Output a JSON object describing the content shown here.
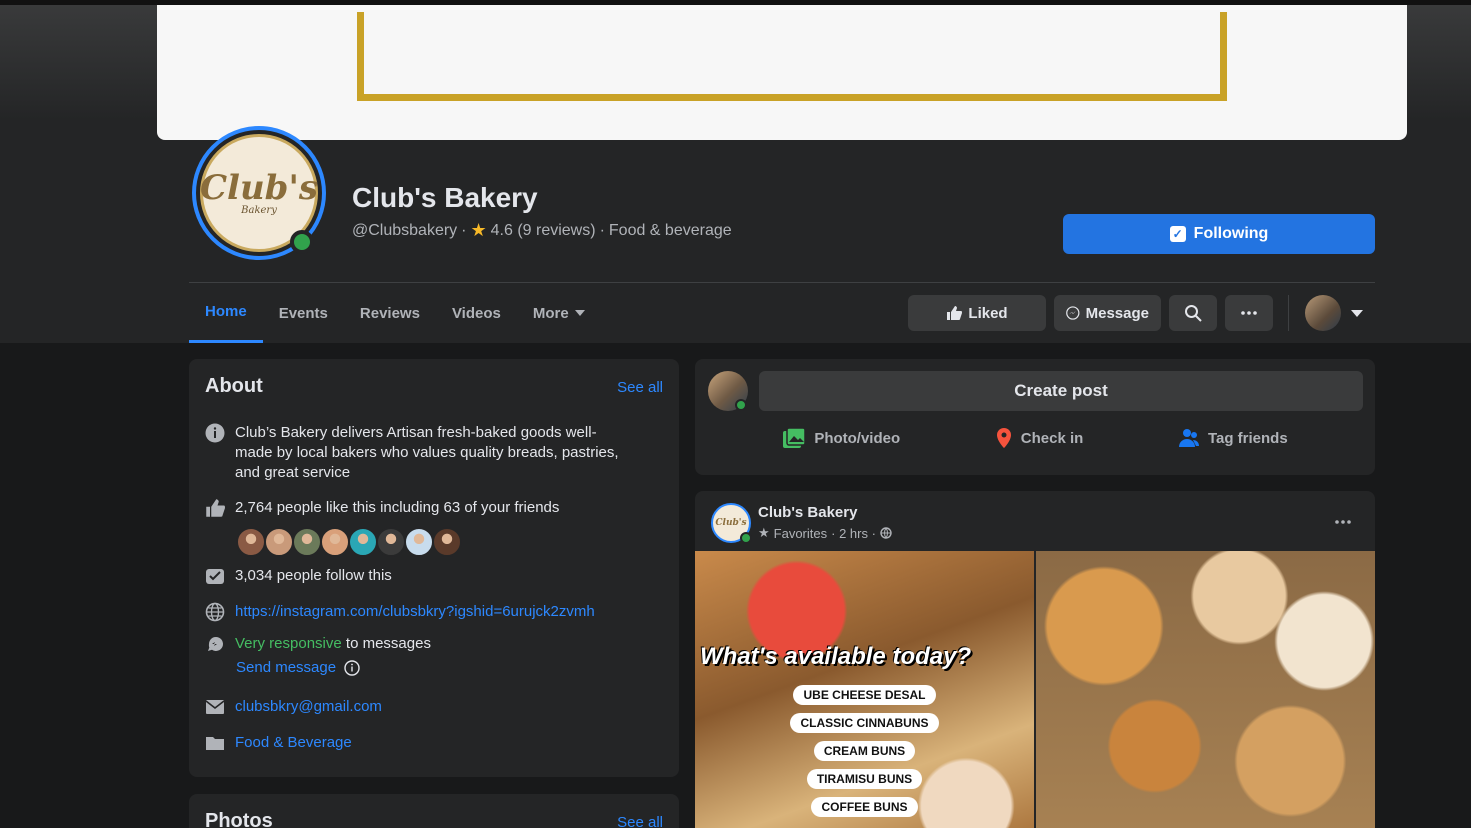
{
  "page": {
    "name": "Club's Bakery",
    "handle": "@Clubsbakery",
    "separator": "·",
    "rating": "4.6 (9 reviews)",
    "category": "Food & beverage",
    "logo_text": "Club's",
    "logo_sub": "Bakery"
  },
  "header": {
    "following_label": "Following"
  },
  "tabs": [
    {
      "label": "Home"
    },
    {
      "label": "Events"
    },
    {
      "label": "Reviews"
    },
    {
      "label": "Videos"
    },
    {
      "label": "More"
    }
  ],
  "actions": {
    "liked_label": "Liked",
    "message_label": "Message"
  },
  "about": {
    "title": "About",
    "see_all": "See all",
    "description": "Club’s Bakery delivers Artisan fresh-baked goods well-made by local bakers who values quality breads, pastries, and great service",
    "likes": "2,764 people like this including 63 of your friends",
    "follows": "3,034 people follow this",
    "website": "https://instagram.com/clubsbkry?igshid=6urujck2zvmh",
    "responsive": "Very responsive",
    "responsive_suffix": " to messages",
    "send_message": "Send message",
    "email": "clubsbkry@gmail.com",
    "category": "Food & Beverage",
    "friend_colors": [
      "#8a5a44",
      "#c99a7a",
      "#6b7a5a",
      "#d9a07a",
      "#2aa7b5",
      "#3b3b3b",
      "#c8dced",
      "#5a3a2a"
    ]
  },
  "photos": {
    "title": "Photos",
    "see_all": "See all"
  },
  "create_post": {
    "label": "Create post",
    "photo_video": "Photo/video",
    "check_in": "Check in",
    "tag_friends": "Tag friends"
  },
  "post": {
    "author": "Club's Bakery",
    "avatar_text": "Club's",
    "audience": "Favorites",
    "time": "· 2 hrs ·",
    "headline": "What's available today?",
    "menu": [
      "UBE CHEESE DESAL",
      "CLASSIC CINNABUNS",
      "CREAM BUNS",
      "TIRAMISU BUNS",
      "COFFEE BUNS"
    ]
  },
  "colors": {
    "accent": "#2d88ff",
    "following_bg": "#2374e1",
    "online": "#31a24c",
    "cover_frame": "#c9a227"
  }
}
